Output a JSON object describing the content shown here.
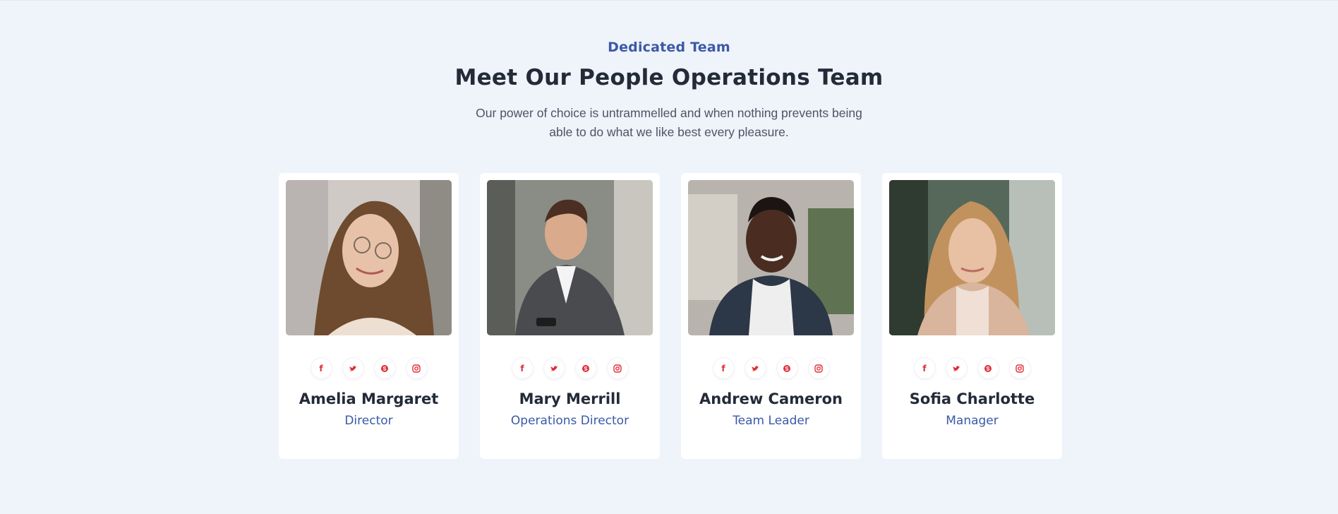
{
  "section": {
    "eyebrow": "Dedicated Team",
    "title": "Meet Our People Operations Team",
    "subtitle": "Our power of choice is untrammelled and when nothing prevents being able to do what we like best every pleasure."
  },
  "social_icons": [
    "facebook-icon",
    "twitter-icon",
    "skype-icon",
    "instagram-icon"
  ],
  "colors": {
    "accent": "#3b59a8",
    "heading": "#232b38",
    "social": "#e0303a",
    "background": "#eff3fa"
  },
  "team": [
    {
      "name": "Amelia Margaret",
      "role": "Director"
    },
    {
      "name": "Mary Merrill",
      "role": "Operations Director"
    },
    {
      "name": "Andrew Cameron",
      "role": "Team Leader"
    },
    {
      "name": "Sofia Charlotte",
      "role": "Manager"
    }
  ]
}
